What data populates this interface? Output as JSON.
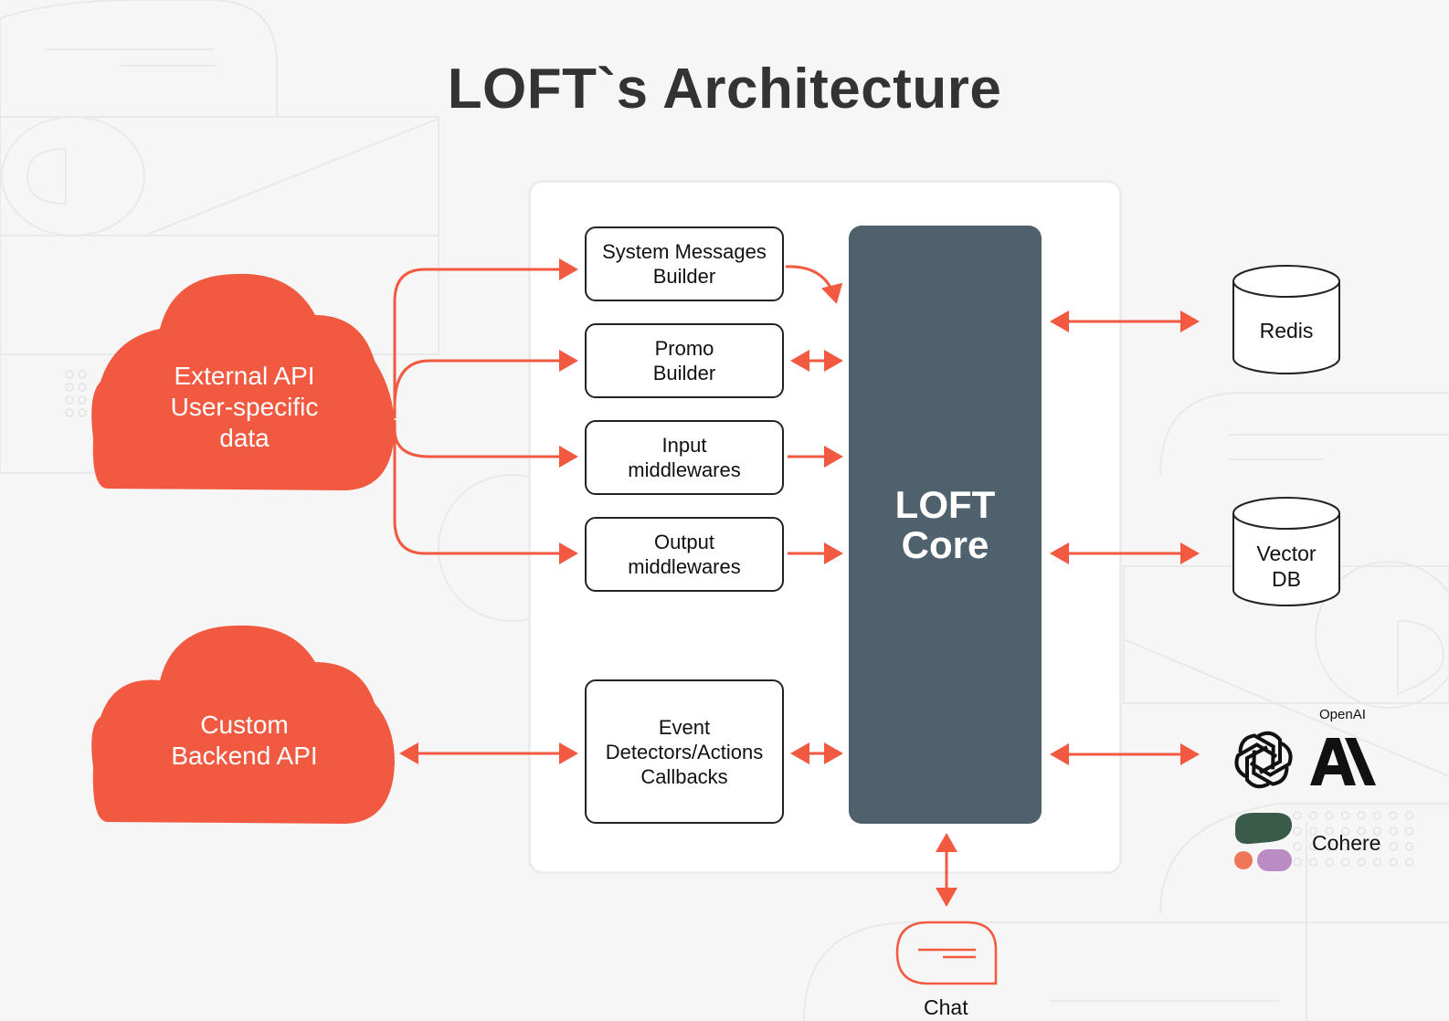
{
  "title": "LOFT`s Architecture",
  "colors": {
    "accent": "#f15a40",
    "core": "#4f616c",
    "background": "#f6f6f6",
    "panel": "#ffffff",
    "cohere_green": "#3a5a4a",
    "cohere_orange": "#ef7659",
    "cohere_purple": "#bb8bc4"
  },
  "sources": [
    {
      "id": "external-api",
      "lines": [
        "External API",
        "User-specific",
        "data"
      ],
      "icon": "cloud-icon"
    },
    {
      "id": "custom-backend-api",
      "lines": [
        "Custom",
        "Backend API"
      ],
      "icon": "cloud-icon"
    }
  ],
  "modules": [
    {
      "id": "system-messages-builder",
      "lines": [
        "System Messages",
        "Builder"
      ]
    },
    {
      "id": "promo-builder",
      "lines": [
        "Promo",
        "Builder"
      ]
    },
    {
      "id": "input-middlewares",
      "lines": [
        "Input",
        "middlewares"
      ]
    },
    {
      "id": "output-middlewares",
      "lines": [
        "Output",
        "middlewares"
      ]
    },
    {
      "id": "event-detectors",
      "lines": [
        "Event",
        "Detectors/Actions",
        "Callbacks"
      ]
    }
  ],
  "core": {
    "lines": [
      "LOFT",
      "Core"
    ]
  },
  "storage": [
    {
      "id": "redis",
      "lines": [
        "Redis"
      ],
      "icon": "database-icon"
    },
    {
      "id": "vector-db",
      "lines": [
        "Vector",
        "DB"
      ],
      "icon": "database-icon"
    }
  ],
  "llm_providers": {
    "openai_label": "OpenAI",
    "openai_icon": "openai-logo-icon",
    "anthropic_icon": "anthropic-logo-icon",
    "cohere_label": "Cohere",
    "cohere_icon": "cohere-logo-icon"
  },
  "chat": {
    "label": "Chat",
    "icon": "chat-bubble-icon"
  },
  "connections": [
    {
      "from": "external-api",
      "to": "system-messages-builder",
      "direction": "forward"
    },
    {
      "from": "external-api",
      "to": "promo-builder",
      "direction": "forward"
    },
    {
      "from": "external-api",
      "to": "input-middlewares",
      "direction": "forward"
    },
    {
      "from": "external-api",
      "to": "output-middlewares",
      "direction": "forward"
    },
    {
      "from": "custom-backend-api",
      "to": "event-detectors",
      "direction": "both"
    },
    {
      "from": "system-messages-builder",
      "to": "loft-core",
      "direction": "forward"
    },
    {
      "from": "promo-builder",
      "to": "loft-core",
      "direction": "both"
    },
    {
      "from": "input-middlewares",
      "to": "loft-core",
      "direction": "forward"
    },
    {
      "from": "output-middlewares",
      "to": "loft-core",
      "direction": "forward"
    },
    {
      "from": "event-detectors",
      "to": "loft-core",
      "direction": "both"
    },
    {
      "from": "loft-core",
      "to": "redis",
      "direction": "both"
    },
    {
      "from": "loft-core",
      "to": "vector-db",
      "direction": "both"
    },
    {
      "from": "loft-core",
      "to": "llm-providers",
      "direction": "both"
    },
    {
      "from": "loft-core",
      "to": "chat",
      "direction": "both"
    }
  ]
}
